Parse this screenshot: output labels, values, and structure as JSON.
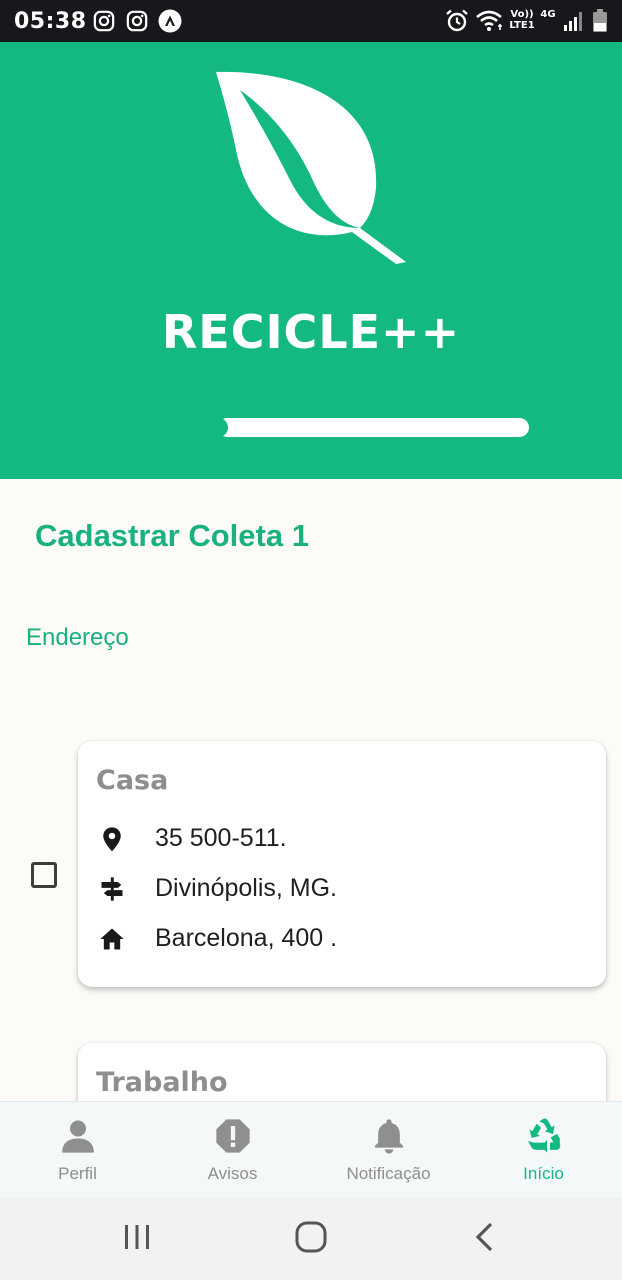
{
  "status_bar": {
    "time": "05:38",
    "icons": [
      "instagram-icon",
      "instagram-icon",
      "app-notification-icon",
      "alarm-icon",
      "wifi-icon",
      "volte-icon",
      "4g-icon",
      "signal-icon",
      "battery-icon"
    ],
    "volte_label": "Vo)) LTE1",
    "network_label": "4G"
  },
  "header": {
    "logo_icon": "leaf-icon",
    "app_name": "RECICLE++",
    "progress_fraction": 1.0
  },
  "page": {
    "title": "Cadastrar Coleta 1",
    "section_label": "Endereço"
  },
  "addresses": [
    {
      "name": "Casa",
      "checked": false,
      "rows": [
        {
          "icon": "location-pin-icon",
          "text": "35 500-511."
        },
        {
          "icon": "signpost-icon",
          "text": "Divinópolis, MG."
        },
        {
          "icon": "home-icon",
          "text": "Barcelona, 400 ."
        }
      ]
    },
    {
      "name": "Trabalho"
    }
  ],
  "bottom_nav": [
    {
      "icon": "person-icon",
      "label": "Perfil",
      "active": false
    },
    {
      "icon": "alert-icon",
      "label": "Avisos",
      "active": false
    },
    {
      "icon": "bell-icon",
      "label": "Notificação",
      "active": false
    },
    {
      "icon": "recycle-icon",
      "label": "Início",
      "active": true
    }
  ],
  "system_nav": [
    "recents-icon",
    "home-circle-icon",
    "back-icon"
  ],
  "colors": {
    "accent": "#13b981",
    "status_bar": "#16181c",
    "background": "#fcfbf8",
    "inactive": "#8f8f8f"
  }
}
